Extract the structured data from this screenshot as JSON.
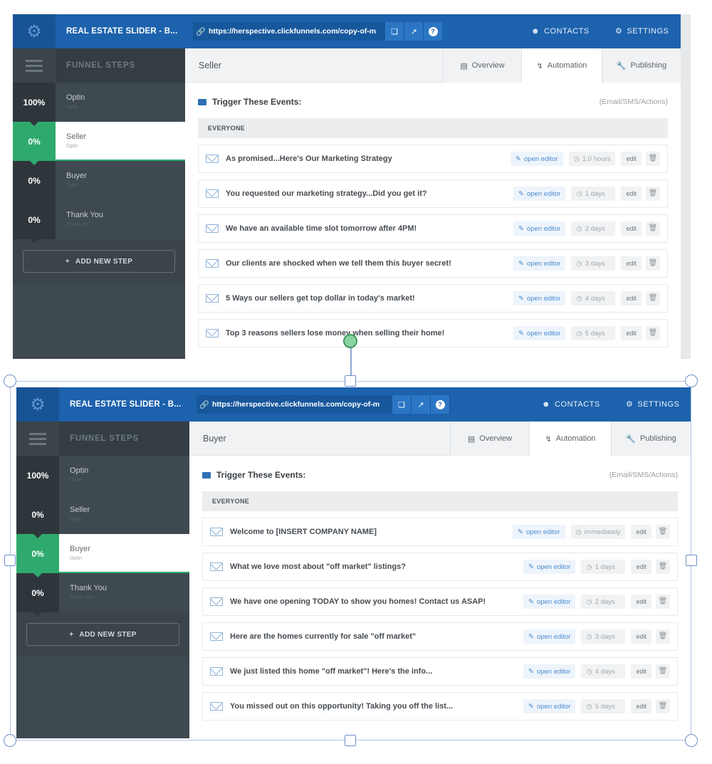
{
  "app": {
    "title": "REAL ESTATE SLIDER - B...",
    "url": "https://herspective.clickfunnels.com/copy-of-m",
    "contacts_label": "CONTACTS",
    "settings_label": "SETTINGS"
  },
  "sidebar": {
    "title": "FUNNEL STEPS",
    "add_step_label": "ADD NEW STEP"
  },
  "tabs": {
    "overview": "Overview",
    "automation": "Automation",
    "publishing": "Publishing"
  },
  "trigger": {
    "title": "Trigger These Events:",
    "types": "(Email/SMS/Actions)",
    "group": "EVERYONE"
  },
  "row_actions": {
    "open_editor": "open editor",
    "edit": "edit"
  },
  "panels": [
    {
      "page_title": "Seller",
      "steps": [
        {
          "pct": "100%",
          "name": "Optin",
          "sub": "Optin"
        },
        {
          "pct": "0%",
          "name": "Seller",
          "sub": "Optin"
        },
        {
          "pct": "0%",
          "name": "Buyer",
          "sub": "Optin"
        },
        {
          "pct": "0%",
          "name": "Thank You",
          "sub": "Thank You"
        }
      ],
      "emails": [
        {
          "subject": "As promised...Here's Our Marketing Strategy",
          "delay": "1.0 hours"
        },
        {
          "subject": "You requested our marketing strategy...Did you get it?",
          "delay": "1 days"
        },
        {
          "subject": "We have an available time slot tomorrow after 4PM!",
          "delay": "2 days"
        },
        {
          "subject": "Our clients are shocked when we tell them this buyer secret!",
          "delay": "3 days"
        },
        {
          "subject": "5 Ways our sellers get top dollar in today's market!",
          "delay": "4 days"
        },
        {
          "subject": "Top 3 reasons sellers lose money when selling their home!",
          "delay": "5 days"
        }
      ]
    },
    {
      "page_title": "Buyer",
      "steps": [
        {
          "pct": "100%",
          "name": "Optin",
          "sub": "Optin"
        },
        {
          "pct": "0%",
          "name": "Seller",
          "sub": "Optin"
        },
        {
          "pct": "0%",
          "name": "Buyer",
          "sub": "Optin"
        },
        {
          "pct": "0%",
          "name": "Thank You",
          "sub": "Thank You"
        }
      ],
      "emails": [
        {
          "subject": "Welcome to [INSERT COMPANY NAME]",
          "delay": "immediately"
        },
        {
          "subject": "What we love most about \"off market\" listings?",
          "delay": "1 days"
        },
        {
          "subject": "We have one opening TODAY to show you homes! Contact us ASAP!",
          "delay": "2 days"
        },
        {
          "subject": "Here are the homes currently for sale \"off market\"",
          "delay": "3 days"
        },
        {
          "subject": "We just listed this home \"off market\"! Here's the info...",
          "delay": "4 days"
        },
        {
          "subject": "You missed out on this opportunity! Taking you off the list...",
          "delay": "5 days"
        }
      ]
    }
  ],
  "icons": {
    "gear": "gear-icon",
    "link": "link-icon",
    "copy": "copy-icon",
    "external": "external-link-icon",
    "help": "help-icon",
    "contacts": "users-icon",
    "settings": "gear-icon",
    "mail": "envelope-icon",
    "clock": "clock-icon",
    "trash": "trash-icon",
    "chart": "bar-chart-icon",
    "bolt": "bolt-icon",
    "wrench": "wrench-icon"
  },
  "colors": {
    "topbar": "#1d62ad",
    "sidebar": "#3f4950",
    "active_step": "#2faa6e",
    "link": "#4c8bcf"
  }
}
